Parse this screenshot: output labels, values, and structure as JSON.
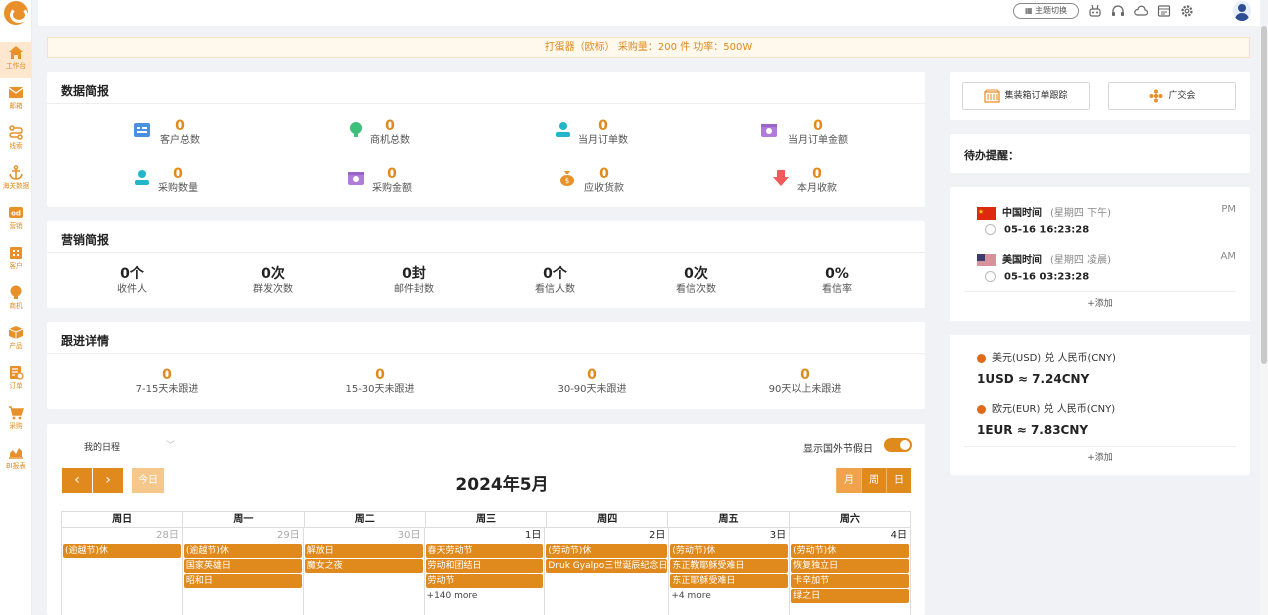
{
  "sidebar": {
    "items": [
      {
        "label": "工作台",
        "icon": "home-icon"
      },
      {
        "label": "邮箱",
        "icon": "mail-icon"
      },
      {
        "label": "线索",
        "icon": "route-icon"
      },
      {
        "label": "海关数据",
        "icon": "anchor-icon"
      },
      {
        "label": "营销",
        "icon": "marketing-icon"
      },
      {
        "label": "客户",
        "icon": "customer-icon"
      },
      {
        "label": "商机",
        "icon": "bulb-icon"
      },
      {
        "label": "产品",
        "icon": "box-icon"
      },
      {
        "label": "订单",
        "icon": "order-icon"
      },
      {
        "label": "采购",
        "icon": "cart-icon"
      },
      {
        "label": "BI报表",
        "icon": "chart-icon"
      }
    ]
  },
  "topbar": {
    "theme_label": "主题切换"
  },
  "notice": {
    "text": "打蛋器（欧标） 采购量：200 件 功率：500W"
  },
  "data_report": {
    "title": "数据简报",
    "stats": [
      {
        "value": "0",
        "label": "客户总数"
      },
      {
        "value": "0",
        "label": "商机总数"
      },
      {
        "value": "0",
        "label": "当月订单数"
      },
      {
        "value": "0",
        "label": "当月订单金额"
      },
      {
        "value": "0",
        "label": "采购数量"
      },
      {
        "value": "0",
        "label": "采购金额"
      },
      {
        "value": "0",
        "label": "应收货款"
      },
      {
        "value": "0",
        "label": "本月收款"
      }
    ]
  },
  "marketing": {
    "title": "营销简报",
    "stats": [
      {
        "value": "0个",
        "label": "收件人"
      },
      {
        "value": "0次",
        "label": "群发次数"
      },
      {
        "value": "0封",
        "label": "邮件封数"
      },
      {
        "value": "0个",
        "label": "看信人数"
      },
      {
        "value": "0次",
        "label": "看信次数"
      },
      {
        "value": "0%",
        "label": "看信率"
      }
    ]
  },
  "followup": {
    "title": "跟进详情",
    "stats": [
      {
        "value": "0",
        "label": "7-15天未跟进"
      },
      {
        "value": "0",
        "label": "15-30天未跟进"
      },
      {
        "value": "0",
        "label": "30-90天未跟进"
      },
      {
        "value": "0",
        "label": "90天以上未跟进"
      }
    ]
  },
  "calendar": {
    "select_value": "我的日程",
    "holiday_toggle_label": "显示国外节假日",
    "prev": "‹",
    "next": "›",
    "today": "今日",
    "title": "2024年5月",
    "views": [
      "月",
      "周",
      "日"
    ],
    "weekdays": [
      "周日",
      "周一",
      "周二",
      "周三",
      "周四",
      "周五",
      "周六"
    ],
    "days": [
      {
        "num": "28日",
        "dim": true,
        "events": [
          "(逾越节)休"
        ],
        "more": ""
      },
      {
        "num": "29日",
        "dim": true,
        "events": [
          "(逾越节)休",
          "国家英雄日",
          "昭和日"
        ],
        "more": ""
      },
      {
        "num": "30日",
        "dim": true,
        "events": [
          "解放日",
          "魔女之夜"
        ],
        "more": ""
      },
      {
        "num": "1日",
        "dim": false,
        "events": [
          "春天劳动节",
          "劳动和团结日",
          "劳动节"
        ],
        "more": "+140 more"
      },
      {
        "num": "2日",
        "dim": false,
        "events": [
          "(劳动节)休",
          "Druk Gyalpo三世诞辰纪念日"
        ],
        "more": ""
      },
      {
        "num": "3日",
        "dim": false,
        "events": [
          "(劳动节)休",
          "东正教耶稣受难日",
          "东正耶稣受难日"
        ],
        "more": "+4 more"
      },
      {
        "num": "4日",
        "dim": false,
        "events": [
          "(劳动节)休",
          "恢复独立日",
          "卡辛加节",
          "绿之日"
        ],
        "more": ""
      }
    ]
  },
  "quick_links": {
    "container": "集装箱订单跟踪",
    "canton": "广交会"
  },
  "todo": {
    "title": "待办提醒："
  },
  "world_clock": {
    "zones": [
      {
        "name": "中国时间",
        "week": "(星期四 下午)",
        "ampm": "PM",
        "time": "05-16 16:23:28"
      },
      {
        "name": "美国时间",
        "week": "(星期四 凌晨)",
        "ampm": "AM",
        "time": "05-16 03:23:28"
      }
    ],
    "add": "+添加"
  },
  "exchange": {
    "rates": [
      {
        "pair": "美元(USD) 兑 人民币(CNY)",
        "value": "1USD ≈ 7.24CNY"
      },
      {
        "pair": "欧元(EUR) 兑 人民币(CNY)",
        "value": "1EUR ≈ 7.83CNY"
      }
    ],
    "add": "+添加"
  },
  "colors": {
    "accent": "#e08a1e",
    "page_bg": "#f0f2f5"
  }
}
